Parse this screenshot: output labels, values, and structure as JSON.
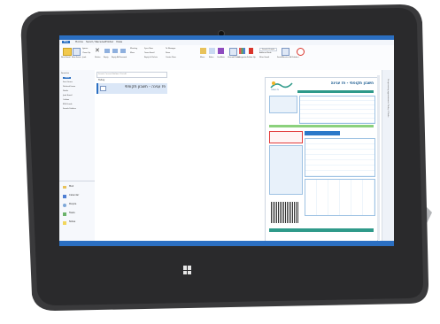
{
  "colors": {
    "accent": "#2b6fc2",
    "tablet_frame": "#3a3a3c",
    "doc_teal": "#2f9a8a",
    "doc_red": "#e23b3b"
  },
  "outlook": {
    "ribbon_tabs": [
      "File",
      "Home",
      "Send / Receive",
      "Folder",
      "View"
    ],
    "ribbon_buttons": [
      "New Email",
      "New Items",
      "Ignore",
      "Clean Up",
      "Junk",
      "Delete",
      "Reply",
      "Reply All",
      "Forward",
      "Meeting",
      "More",
      "Sync Now",
      "Team Email",
      "Reply & Delete",
      "To Manager",
      "Done",
      "Create New",
      "Move",
      "Rules",
      "OneNote",
      "Unread/ Read",
      "Categorize",
      "Follow Up",
      "Search People",
      "Address Book",
      "Filter Email",
      "Send/Receive All Folders"
    ],
    "folder_pane_items": [
      "Favorites",
      "Inbox",
      "Sent Items",
      "Deleted Items",
      "Drafts",
      "Junk Email",
      "Outbox",
      "RSS Feeds",
      "Search Folders"
    ],
    "nav_items": [
      "Mail",
      "Calendar",
      "People",
      "Tasks",
      "Notes"
    ],
    "mail_list": {
      "search_placeholder": "Search Current Mailbox (Ctrl+E)",
      "group": "Today",
      "item_title": "פז עגינה - חשבון תקופתי"
    },
    "reading_pane": {
      "doc_title": "חשבון תקופתי - פז עגינה",
      "logo_text": "פז עגינה"
    },
    "todo_bar_label": "No upcoming appointments. Today: 0 Tasks"
  }
}
